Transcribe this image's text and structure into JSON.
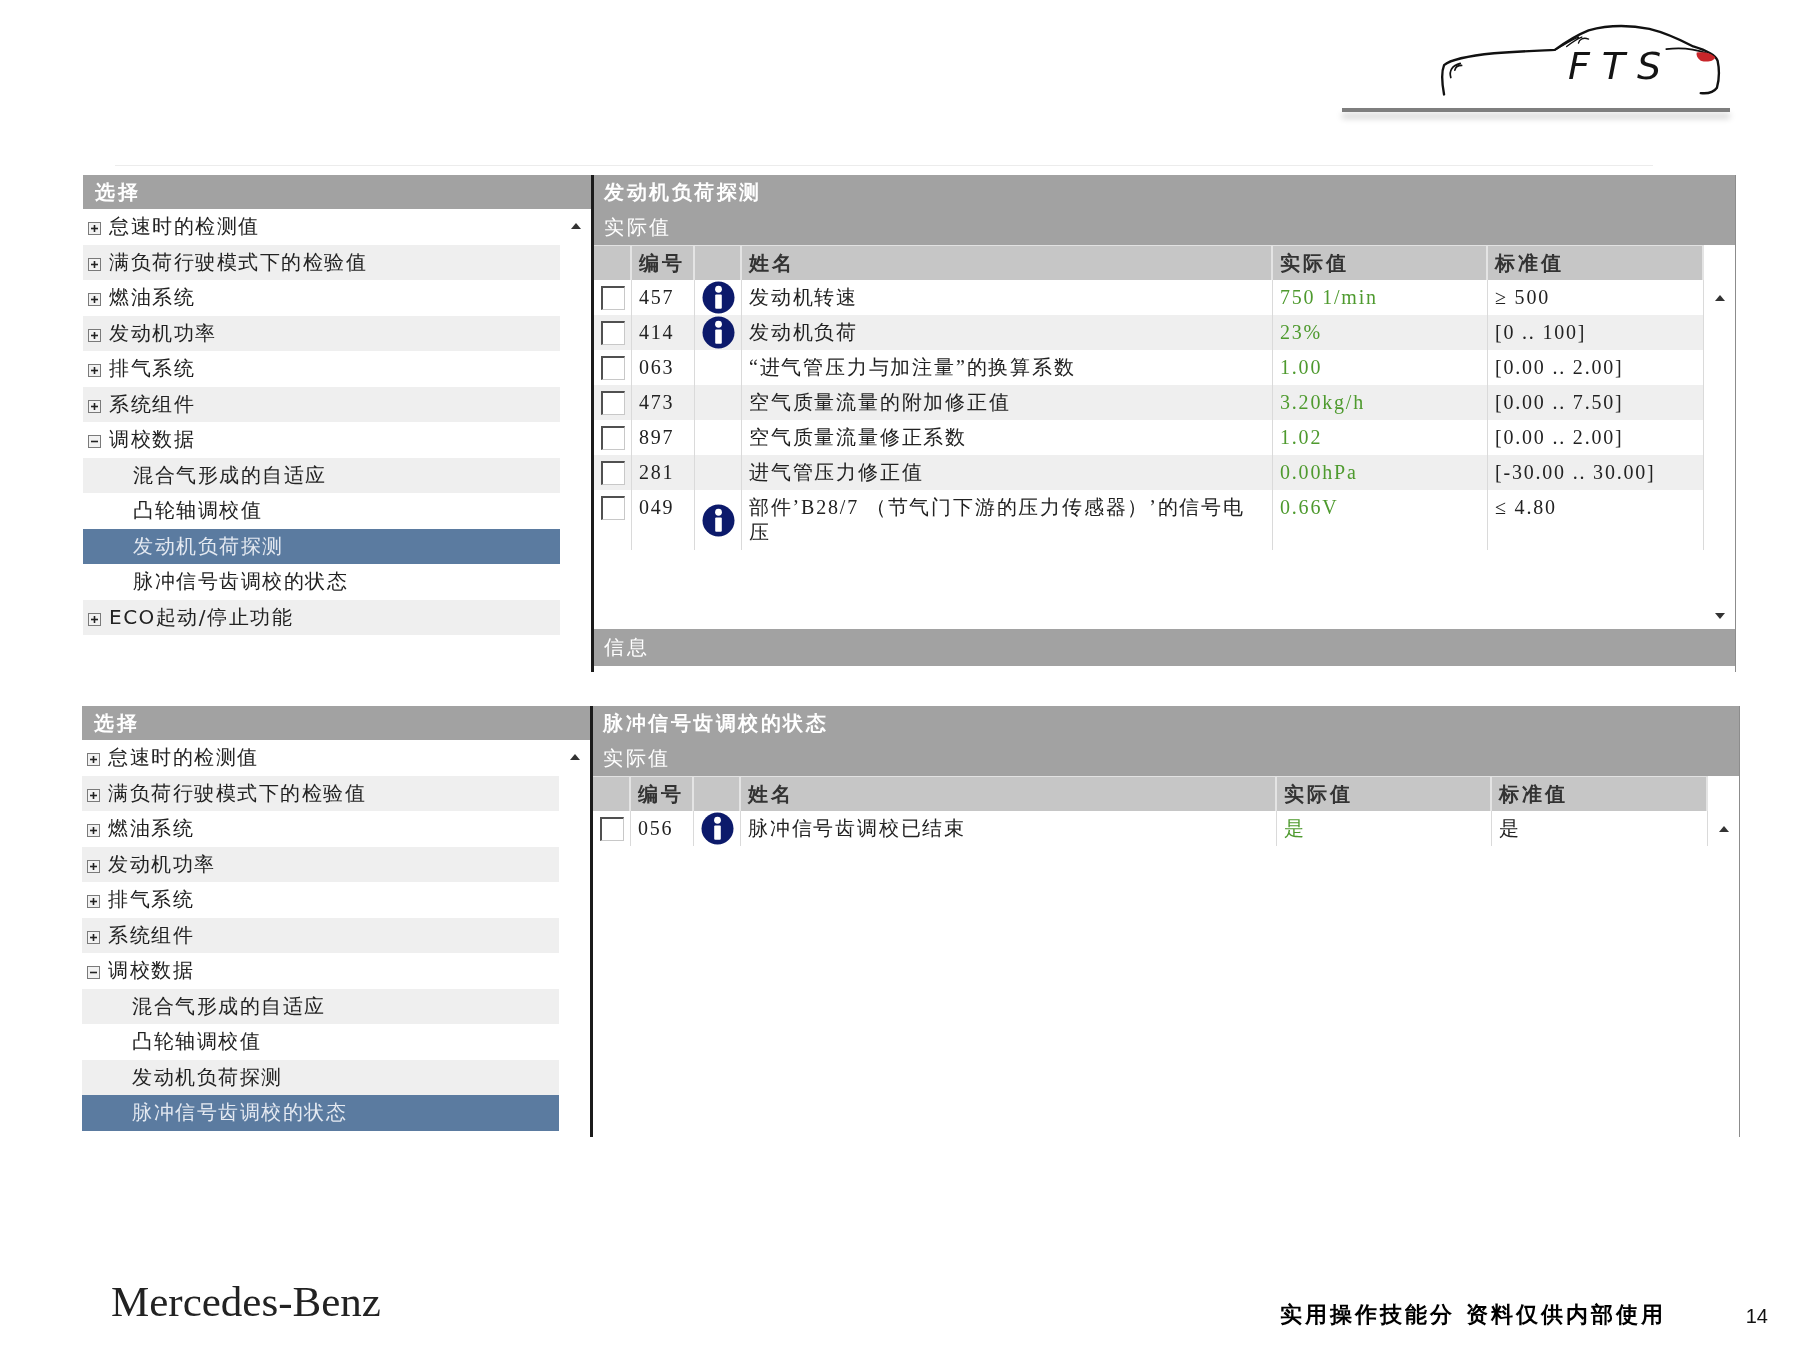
{
  "logo": {
    "text": "FTS"
  },
  "panels": [
    {
      "tree": {
        "title": "选择",
        "items": [
          {
            "label": "怠速时的检测值",
            "expanded": false,
            "selected": false
          },
          {
            "label": "满负荷行驶模式下的检验值",
            "expanded": false,
            "selected": false
          },
          {
            "label": "燃油系统",
            "expanded": false,
            "selected": false
          },
          {
            "label": "发动机功率",
            "expanded": false,
            "selected": false
          },
          {
            "label": "排气系统",
            "expanded": false,
            "selected": false
          },
          {
            "label": "系统组件",
            "expanded": false,
            "selected": false
          },
          {
            "label": "调校数据",
            "expanded": true,
            "selected": false,
            "children": [
              {
                "label": "混合气形成的自适应",
                "selected": false
              },
              {
                "label": "凸轮轴调校值",
                "selected": false
              },
              {
                "label": "发动机负荷探测",
                "selected": true
              },
              {
                "label": "脉冲信号齿调校的状态",
                "selected": false
              }
            ]
          },
          {
            "label": "ECO起动/停止功能",
            "expanded": false,
            "selected": false
          }
        ]
      },
      "detail": {
        "title": "发动机负荷探测",
        "subtitle": "实际值",
        "columns": [
          "编号",
          "姓名",
          "实际值",
          "标准值"
        ],
        "rows": [
          {
            "checked": false,
            "number": "457",
            "has_info": true,
            "name": "发动机转速",
            "actual": "750 1/min",
            "standard": "≥ 500"
          },
          {
            "checked": false,
            "number": "414",
            "has_info": true,
            "name": "发动机负荷",
            "actual": "23%",
            "standard": "[0 .. 100]"
          },
          {
            "checked": false,
            "number": "063",
            "has_info": false,
            "name": "“进气管压力与加注量”的换算系数",
            "actual": "1.00",
            "standard": "[0.00 .. 2.00]"
          },
          {
            "checked": false,
            "number": "473",
            "has_info": false,
            "name": "空气质量流量的附加修正值",
            "actual": "3.20kg/h",
            "standard": "[0.00 .. 7.50]"
          },
          {
            "checked": false,
            "number": "897",
            "has_info": false,
            "name": "空气质量流量修正系数",
            "actual": "1.02",
            "standard": "[0.00 .. 2.00]"
          },
          {
            "checked": false,
            "number": "281",
            "has_info": false,
            "name": "进气管压力修正值",
            "actual": "0.00hPa",
            "standard": "[-30.00 .. 30.00]"
          },
          {
            "checked": false,
            "number": "049",
            "has_info": true,
            "name": "部件’B28/7 （节气门下游的压力传感器）’的信号电压",
            "actual": "0.66V",
            "standard": "≤ 4.80"
          }
        ],
        "info_bar": "信息"
      }
    },
    {
      "tree": {
        "title": "选择",
        "items": [
          {
            "label": "怠速时的检测值",
            "expanded": false,
            "selected": false
          },
          {
            "label": "满负荷行驶模式下的检验值",
            "expanded": false,
            "selected": false
          },
          {
            "label": "燃油系统",
            "expanded": false,
            "selected": false
          },
          {
            "label": "发动机功率",
            "expanded": false,
            "selected": false
          },
          {
            "label": "排气系统",
            "expanded": false,
            "selected": false
          },
          {
            "label": "系统组件",
            "expanded": false,
            "selected": false
          },
          {
            "label": "调校数据",
            "expanded": true,
            "selected": false,
            "children": [
              {
                "label": "混合气形成的自适应",
                "selected": false
              },
              {
                "label": "凸轮轴调校值",
                "selected": false
              },
              {
                "label": "发动机负荷探测",
                "selected": false
              },
              {
                "label": "脉冲信号齿调校的状态",
                "selected": true
              }
            ]
          }
        ]
      },
      "detail": {
        "title": "脉冲信号齿调校的状态",
        "subtitle": "实际值",
        "columns": [
          "编号",
          "姓名",
          "实际值",
          "标准值"
        ],
        "rows": [
          {
            "checked": false,
            "number": "056",
            "has_info": true,
            "name": "脉冲信号齿调校已结束",
            "actual": "是",
            "standard": "是"
          }
        ]
      }
    }
  ],
  "footer": {
    "brand": "Mercedes-Benz",
    "note": "实用操作技能分 资料仅供内部使用",
    "page": "14"
  }
}
